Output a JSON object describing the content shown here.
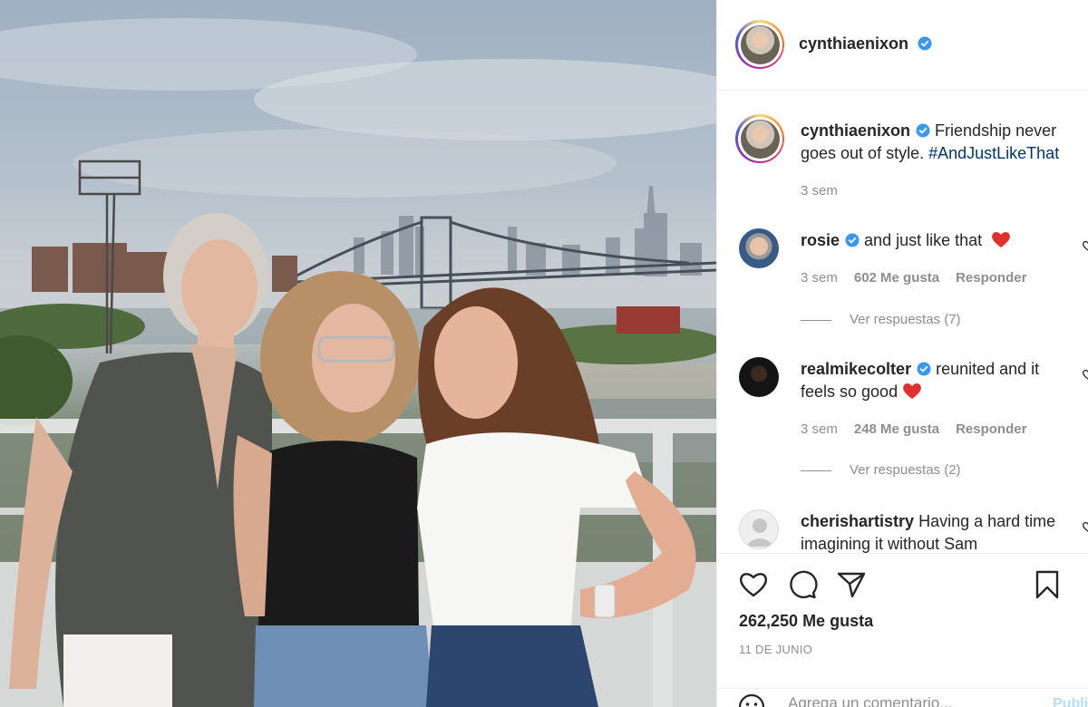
{
  "post": {
    "author": "cynthiaenixon",
    "caption": "Friendship never goes out of style.",
    "hashtag": "#AndJustLikeThat",
    "caption_time": "3 sem",
    "likes": "262,250 Me gusta",
    "date": "11 DE JUNIO",
    "add_comment_placeholder": "Agrega un comentario...",
    "publish_label": "Publicar"
  },
  "comments": [
    {
      "username": "rosie",
      "text": "and just like that",
      "time": "3 sem",
      "likes": "602 Me gusta",
      "reply_label": "Responder",
      "view_replies": "Ver respuestas (7)"
    },
    {
      "username": "realmikecolter",
      "text": "reunited and it feels so good",
      "time": "3 sem",
      "likes": "248 Me gusta",
      "reply_label": "Responder",
      "view_replies": "Ver respuestas (2)"
    },
    {
      "username": "cherishartistry",
      "text": "Having a hard time imagining it without Sam"
    }
  ],
  "icons": {
    "verified": "verified-badge-icon",
    "like": "heart-icon",
    "comment": "comment-bubble-icon",
    "share": "paper-plane-icon",
    "save": "bookmark-icon",
    "emoji": "smiley-icon"
  },
  "colors": {
    "verified_blue": "#3897f0",
    "hashtag_blue": "#00376b",
    "muted_gray": "#8e8e8e",
    "heart_red": "#ed4956"
  }
}
